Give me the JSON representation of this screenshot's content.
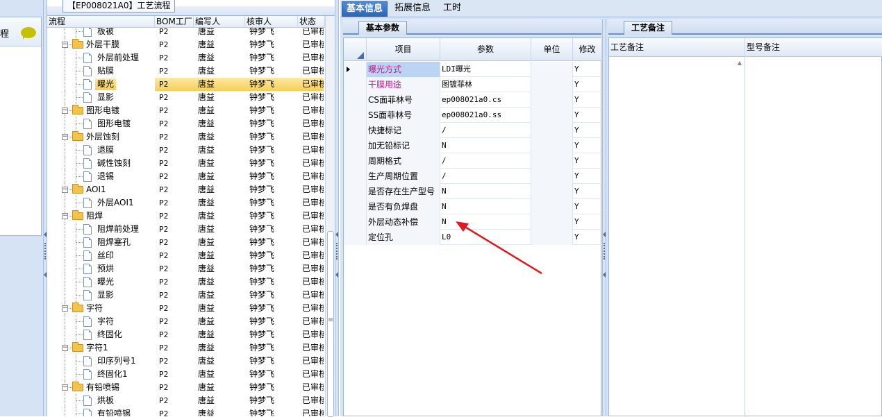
{
  "left_panel": {
    "title": "程"
  },
  "tree_panel": {
    "tab_label": "【EP008021A0】工艺流程",
    "columns": [
      "流程",
      "BOM工厂",
      "编写人",
      "核审人",
      "状态"
    ],
    "rows": [
      {
        "label": "板被",
        "kind": "leaf",
        "bom": "P2",
        "author": "唐益",
        "reviewer": "钟梦飞",
        "status": "已审核"
      },
      {
        "label": "外层干膜",
        "kind": "group",
        "bom": "P2",
        "author": "唐益",
        "reviewer": "钟梦飞",
        "status": "已审核"
      },
      {
        "label": "外层前处理",
        "kind": "leaf",
        "bom": "P2",
        "author": "唐益",
        "reviewer": "钟梦飞",
        "status": "已审核"
      },
      {
        "label": "贴膜",
        "kind": "leaf",
        "bom": "P2",
        "author": "唐益",
        "reviewer": "钟梦飞",
        "status": "已审核"
      },
      {
        "label": "曝光",
        "kind": "leaf",
        "bom": "P2",
        "author": "唐益",
        "reviewer": "钟梦飞",
        "status": "已审核",
        "selected": true
      },
      {
        "label": "显影",
        "kind": "leaf",
        "bom": "P2",
        "author": "唐益",
        "reviewer": "钟梦飞",
        "status": "已审核"
      },
      {
        "label": "图形电镀",
        "kind": "group",
        "bom": "P2",
        "author": "唐益",
        "reviewer": "钟梦飞",
        "status": "已审核"
      },
      {
        "label": "图形电镀",
        "kind": "leaf",
        "bom": "P2",
        "author": "唐益",
        "reviewer": "钟梦飞",
        "status": "已审核"
      },
      {
        "label": "外层蚀刻",
        "kind": "group",
        "bom": "P2",
        "author": "唐益",
        "reviewer": "钟梦飞",
        "status": "已审核"
      },
      {
        "label": "退膜",
        "kind": "leaf",
        "bom": "P2",
        "author": "唐益",
        "reviewer": "钟梦飞",
        "status": "已审核"
      },
      {
        "label": "碱性蚀刻",
        "kind": "leaf",
        "bom": "P2",
        "author": "唐益",
        "reviewer": "钟梦飞",
        "status": "已审核"
      },
      {
        "label": "退锡",
        "kind": "leaf",
        "bom": "P2",
        "author": "唐益",
        "reviewer": "钟梦飞",
        "status": "已审核"
      },
      {
        "label": "AOI1",
        "kind": "group",
        "bom": "P2",
        "author": "唐益",
        "reviewer": "钟梦飞",
        "status": "已审核"
      },
      {
        "label": "外层AOI1",
        "kind": "leaf",
        "bom": "P2",
        "author": "唐益",
        "reviewer": "钟梦飞",
        "status": "已审核"
      },
      {
        "label": "阻焊",
        "kind": "group",
        "bom": "P2",
        "author": "唐益",
        "reviewer": "钟梦飞",
        "status": "已审核"
      },
      {
        "label": "阻焊前处理",
        "kind": "leaf",
        "bom": "P2",
        "author": "唐益",
        "reviewer": "钟梦飞",
        "status": "已审核"
      },
      {
        "label": "阻焊塞孔",
        "kind": "leaf",
        "bom": "P2",
        "author": "唐益",
        "reviewer": "钟梦飞",
        "status": "已审核"
      },
      {
        "label": "丝印",
        "kind": "leaf",
        "bom": "P2",
        "author": "唐益",
        "reviewer": "钟梦飞",
        "status": "已审核"
      },
      {
        "label": "预烘",
        "kind": "leaf",
        "bom": "P2",
        "author": "唐益",
        "reviewer": "钟梦飞",
        "status": "已审核"
      },
      {
        "label": "曝光",
        "kind": "leaf",
        "bom": "P2",
        "author": "唐益",
        "reviewer": "钟梦飞",
        "status": "已审核"
      },
      {
        "label": "显影",
        "kind": "leaf",
        "bom": "P2",
        "author": "唐益",
        "reviewer": "钟梦飞",
        "status": "已审核"
      },
      {
        "label": "字符",
        "kind": "group",
        "bom": "P2",
        "author": "唐益",
        "reviewer": "钟梦飞",
        "status": "已审核"
      },
      {
        "label": "字符",
        "kind": "leaf",
        "bom": "P2",
        "author": "唐益",
        "reviewer": "钟梦飞",
        "status": "已审核"
      },
      {
        "label": "终固化",
        "kind": "leaf",
        "bom": "P2",
        "author": "唐益",
        "reviewer": "钟梦飞",
        "status": "已审核"
      },
      {
        "label": "字符1",
        "kind": "group",
        "bom": "P2",
        "author": "唐益",
        "reviewer": "钟梦飞",
        "status": "已审核"
      },
      {
        "label": "印序列号1",
        "kind": "leaf",
        "bom": "P2",
        "author": "唐益",
        "reviewer": "钟梦飞",
        "status": "已审核"
      },
      {
        "label": "终固化1",
        "kind": "leaf",
        "bom": "P2",
        "author": "唐益",
        "reviewer": "钟梦飞",
        "status": "已审核"
      },
      {
        "label": "有铅喷锡",
        "kind": "group",
        "bom": "P2",
        "author": "唐益",
        "reviewer": "钟梦飞",
        "status": "已审核"
      },
      {
        "label": "烘板",
        "kind": "leaf",
        "bom": "P2",
        "author": "唐益",
        "reviewer": "钟梦飞",
        "status": "已审核"
      },
      {
        "label": "有铅喷锡",
        "kind": "leaf",
        "bom": "P2",
        "author": "唐益",
        "reviewer": "钟梦飞",
        "status": "已审核"
      }
    ]
  },
  "top_tabs": [
    {
      "label": "基本信息",
      "active": true
    },
    {
      "label": "拓展信息",
      "active": false
    },
    {
      "label": "工时",
      "active": false
    }
  ],
  "params_panel": {
    "subtab": "基本参数",
    "columns": [
      "项目",
      "参数",
      "单位",
      "修改"
    ],
    "rows": [
      {
        "item": "曝光方式",
        "value": "LDI曝光",
        "unit": "",
        "modify": "Y",
        "highlight": true,
        "current": true
      },
      {
        "item": "干膜用途",
        "value": "图镀菲林",
        "unit": "",
        "modify": "Y",
        "highlight": true
      },
      {
        "item": "CS面菲林号",
        "value": "ep008021a0.cs",
        "unit": "",
        "modify": "Y"
      },
      {
        "item": "SS面菲林号",
        "value": "ep008021a0.ss",
        "unit": "",
        "modify": "Y"
      },
      {
        "item": "快捷标记",
        "value": "/",
        "unit": "",
        "modify": "Y"
      },
      {
        "item": "加无铅标记",
        "value": "N",
        "unit": "",
        "modify": "Y"
      },
      {
        "item": "周期格式",
        "value": "/",
        "unit": "",
        "modify": "Y"
      },
      {
        "item": "生产周期位置",
        "value": "/",
        "unit": "",
        "modify": "Y"
      },
      {
        "item": "是否存在生产型号",
        "value": "N",
        "unit": "",
        "modify": "Y"
      },
      {
        "item": "是否有负焊盘",
        "value": "N",
        "unit": "",
        "modify": "Y"
      },
      {
        "item": "外层动态补偿",
        "value": "N",
        "unit": "",
        "modify": "Y"
      },
      {
        "item": "定位孔",
        "value": "L0",
        "unit": "",
        "modify": "Y"
      }
    ]
  },
  "notes_panel": {
    "subtab": "工艺备注",
    "columns": [
      "工艺备注",
      "型号备注"
    ]
  },
  "annotation": {
    "color": "#e0191e"
  },
  "colors": {
    "selected_row": "#f7cf55",
    "active_tab": "#2e67b6",
    "highlight_text": "#c0198f"
  }
}
